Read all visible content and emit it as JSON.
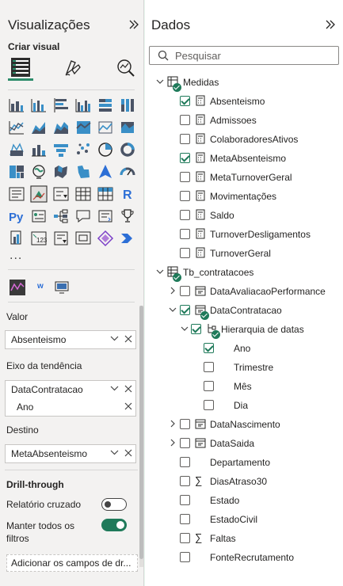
{
  "visualizations": {
    "title": "Visualizações",
    "create_visual": "Criar visual",
    "more_label": "...",
    "small_visual_letter": "w"
  },
  "wells": {
    "valor_label": "Valor",
    "valor_field": "Absenteismo",
    "trend_label": "Eixo da tendência",
    "trend_field": "DataContratacao",
    "trend_subfield": "Ano",
    "target_label": "Destino",
    "target_field": "MetaAbsenteismo",
    "drill_title": "Drill-through",
    "cross_report": "Relatório cruzado",
    "cross_report_on": false,
    "keep_filters": "Manter todos os filtros",
    "keep_filters_on": true,
    "add_fields": "Adicionar os campos de dr..."
  },
  "data": {
    "title": "Dados",
    "search_placeholder": "Pesquisar",
    "tables": [
      {
        "name": "Medidas",
        "fields": [
          {
            "name": "Absenteismo",
            "checked": true
          },
          {
            "name": "Admissoes",
            "checked": false
          },
          {
            "name": "ColaboradoresAtivos",
            "checked": false
          },
          {
            "name": "MetaAbsenteismo",
            "checked": true
          },
          {
            "name": "MetaTurnoverGeral",
            "checked": false
          },
          {
            "name": "Movimentações",
            "checked": false
          },
          {
            "name": "Saldo",
            "checked": false
          },
          {
            "name": "TurnoverDesligamentos",
            "checked": false
          },
          {
            "name": "TurnoverGeral",
            "checked": false
          }
        ]
      },
      {
        "name": "Tb_contratacoes",
        "fields": [
          {
            "name": "DataAvaliacaoPerformance"
          },
          {
            "name": "DataContratacao"
          },
          {
            "name": "Hierarquia de datas"
          },
          {
            "name": "Ano"
          },
          {
            "name": "Trimestre"
          },
          {
            "name": "Mês"
          },
          {
            "name": "Dia"
          },
          {
            "name": "DataNascimento"
          },
          {
            "name": "DataSaida"
          },
          {
            "name": "Departamento"
          },
          {
            "name": "DiasAtraso30"
          },
          {
            "name": "Estado"
          },
          {
            "name": "EstadoCivil"
          },
          {
            "name": "Faltas"
          },
          {
            "name": "FonteRecrutamento"
          }
        ]
      }
    ]
  },
  "colors": {
    "accent": "#1f7a5a",
    "pane_bg": "#f3f2f1",
    "outer_bg": "#e9f7ee"
  }
}
